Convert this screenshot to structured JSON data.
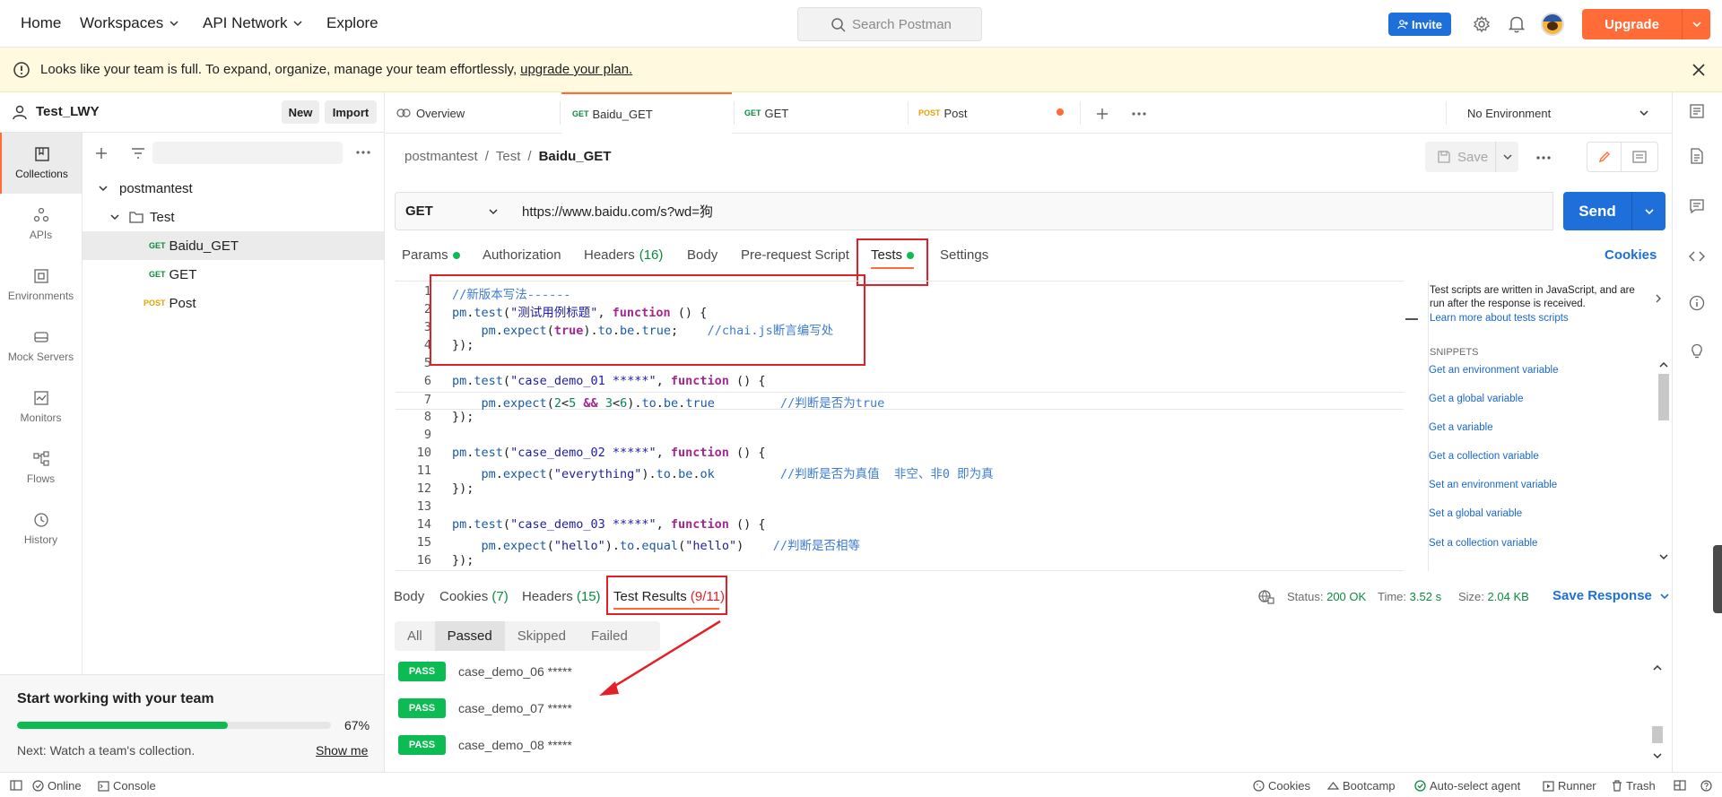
{
  "topbar": {
    "nav": [
      "Home",
      "Workspaces",
      "API Network",
      "Explore"
    ],
    "search_placeholder": "Search Postman",
    "invite_label": "Invite",
    "upgrade_label": "Upgrade"
  },
  "banner": {
    "text": "Looks like your team is full. To expand, organize, manage your team effortlessly,",
    "link": "upgrade your plan."
  },
  "workspace": {
    "name": "Test_LWY",
    "new_label": "New",
    "import_label": "Import"
  },
  "rail": [
    "Collections",
    "APIs",
    "Environments",
    "Mock Servers",
    "Monitors",
    "Flows",
    "History"
  ],
  "tree": {
    "collection": "postmantest",
    "folder": "Test",
    "requests": [
      {
        "method": "GET",
        "name": "Baidu_GET"
      },
      {
        "method": "GET",
        "name": "GET"
      },
      {
        "method": "POST",
        "name": "Post"
      }
    ]
  },
  "teamcard": {
    "title": "Start working with your team",
    "progress_pct": 67,
    "progress_label": "67%",
    "next": "Next: Watch a team's collection.",
    "show_me": "Show me"
  },
  "tabs": [
    {
      "method": "",
      "label": "Overview"
    },
    {
      "method": "GET",
      "label": "Baidu_GET"
    },
    {
      "method": "GET",
      "label": "GET"
    },
    {
      "method": "POST",
      "label": "Post"
    }
  ],
  "environment": "No Environment",
  "breadcrumb": [
    "postmantest",
    "Test",
    "Baidu_GET"
  ],
  "save_label": "Save",
  "request": {
    "method": "GET",
    "url": "https://www.baidu.com/s?wd=狗",
    "send_label": "Send"
  },
  "request_tabs": {
    "params": "Params",
    "authorization": "Authorization",
    "headers": "Headers",
    "headers_count": "(16)",
    "body": "Body",
    "prerequest": "Pre-request Script",
    "tests": "Tests",
    "settings": "Settings",
    "cookies": "Cookies"
  },
  "code_lines": [
    "//新版本写法------",
    "pm.test(\"测试用例标题\", function () {",
    "    pm.expect(true).to.be.true;    //chai.js断言编写处",
    "});",
    "",
    "pm.test(\"case_demo_01 *****\", function () {",
    "    pm.expect(2<5 && 3<6).to.be.true         //判断是否为true",
    "});",
    "",
    "pm.test(\"case_demo_02 *****\", function () {",
    "    pm.expect(\"everything\").to.be.ok         //判断是否为真值  非空、非0 即为真",
    "});",
    "",
    "pm.test(\"case_demo_03 *****\", function () {",
    "    pm.expect(\"hello\").to.equal(\"hello\")    //判断是否相等",
    "});"
  ],
  "snippets_panel": {
    "intro": "Test scripts are written in JavaScript, and are run after the response is received.",
    "learn_more": "Learn more about tests scripts",
    "heading": "SNIPPETS",
    "items": [
      "Get an environment variable",
      "Get a global variable",
      "Get a variable",
      "Get a collection variable",
      "Set an environment variable",
      "Set a global variable",
      "Set a collection variable"
    ]
  },
  "response": {
    "body": "Body",
    "cookies": "Cookies",
    "cookies_count": "(7)",
    "headers": "Headers",
    "headers_count": "(15)",
    "test_results": "Test Results",
    "test_results_count": "(9/11)",
    "status_label": "Status:",
    "status": "200 OK",
    "time_label": "Time:",
    "time": "3.52 s",
    "size_label": "Size:",
    "size": "2.04 KB",
    "save_response": "Save Response"
  },
  "filters": [
    "All",
    "Passed",
    "Skipped",
    "Failed"
  ],
  "results": [
    {
      "badge": "PASS",
      "name": "case_demo_06 *****"
    },
    {
      "badge": "PASS",
      "name": "case_demo_07 *****"
    },
    {
      "badge": "PASS",
      "name": "case_demo_08 *****"
    }
  ],
  "footer": {
    "online": "Online",
    "console": "Console",
    "cookies": "Cookies",
    "bootcamp": "Bootcamp",
    "agent": "Auto-select agent",
    "runner": "Runner",
    "trash": "Trash"
  },
  "colors": {
    "accent": "#ff6c37",
    "primary": "#1e6fd9",
    "pass": "#0cbb52",
    "highlight": "#e12127"
  }
}
